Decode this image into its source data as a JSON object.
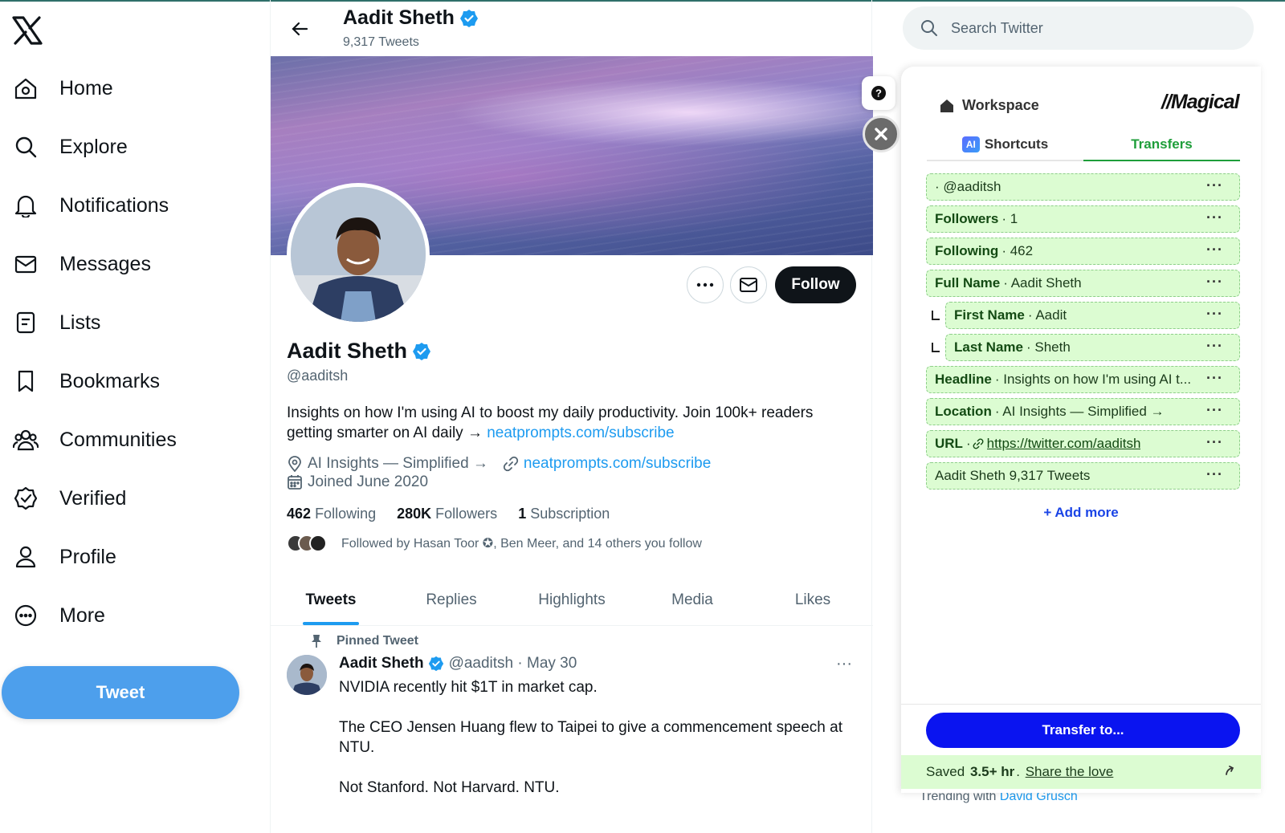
{
  "nav": {
    "items": [
      {
        "label": "Home"
      },
      {
        "label": "Explore"
      },
      {
        "label": "Notifications"
      },
      {
        "label": "Messages"
      },
      {
        "label": "Lists"
      },
      {
        "label": "Bookmarks"
      },
      {
        "label": "Communities"
      },
      {
        "label": "Verified"
      },
      {
        "label": "Profile"
      },
      {
        "label": "More"
      }
    ],
    "tweet_label": "Tweet"
  },
  "header": {
    "name": "Aadit Sheth",
    "tweet_count": "9,317 Tweets"
  },
  "profile": {
    "name": "Aadit Sheth",
    "handle": "@aaditsh",
    "bio_text": "Insights on how I'm using AI to boost my daily productivity. Join 100k+ readers getting smarter on AI daily → ",
    "bio_link": "neatprompts.com/subscribe",
    "location": "AI Insights — Simplified →",
    "website": "neatprompts.com/subscribe",
    "joined": "Joined June 2020",
    "follow_label": "Follow",
    "following_count": "462",
    "following_label": "Following",
    "followers_count": "280K",
    "followers_label": "Followers",
    "subscription_count": "1",
    "subscription_label": "Subscription",
    "followed_by": "Followed by Hasan Toor ✪, Ben Meer, and 14 others you follow"
  },
  "tabs": [
    {
      "label": "Tweets",
      "active": true
    },
    {
      "label": "Replies"
    },
    {
      "label": "Highlights"
    },
    {
      "label": "Media"
    },
    {
      "label": "Likes"
    }
  ],
  "tweet": {
    "pinned_label": "Pinned Tweet",
    "author": "Aadit Sheth",
    "meta": "@aaditsh · May 30",
    "more": "···",
    "paragraphs": [
      "NVIDIA recently hit $1T in market cap.",
      "The CEO Jensen Huang flew to Taipei to give a commencement speech at NTU.",
      "Not Stanford. Not Harvard. NTU."
    ]
  },
  "search": {
    "placeholder": "Search Twitter"
  },
  "trending": {
    "prefix": "Trending with",
    "link": "David Grusch"
  },
  "magical": {
    "workspace": "Workspace",
    "brand": "//Magical",
    "tabs": [
      {
        "label": "Shortcuts",
        "badge": "AI"
      },
      {
        "label": "Transfers",
        "active": true
      }
    ],
    "fields": [
      {
        "label": "",
        "value": "· @aaditsh"
      },
      {
        "label": "Followers",
        "value": "· 1"
      },
      {
        "label": "Following",
        "value": "· 462"
      },
      {
        "label": "Full Name",
        "value": "· Aadit Sheth"
      },
      {
        "label": "First Name",
        "value": "· Aadit",
        "sub": true
      },
      {
        "label": "Last Name",
        "value": "· Sheth",
        "sub": true
      },
      {
        "label": "Headline",
        "value": "· Insights on how I'm using AI t..."
      },
      {
        "label": "Location",
        "value": "· AI Insights — Simplified →"
      },
      {
        "label": "URL",
        "value": "https://twitter.com/aaditsh",
        "prefix": "·"
      },
      {
        "label": "",
        "value": "Aadit Sheth 9,317 Tweets"
      }
    ],
    "field_menu": "···",
    "add_more": "+ Add more",
    "transfer_label": "Transfer to...",
    "saved_prefix": "Saved",
    "saved_amount": "3.5+ hr",
    "saved_sep": ".",
    "share_label": "Share the love",
    "help_label": "?"
  },
  "colors": {
    "twitter_blue": "#1d9bf0",
    "tweet_button": "#4d9fec",
    "magical_green": "#1e9e3a",
    "transfer_blue": "#0a14f0"
  }
}
